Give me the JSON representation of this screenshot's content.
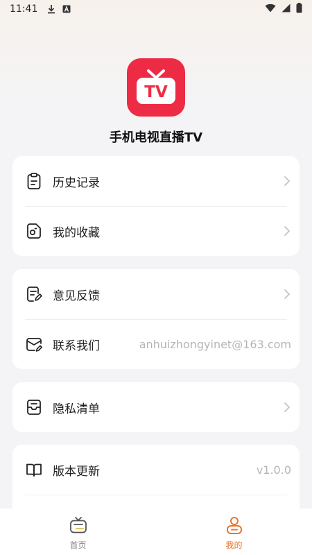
{
  "status_bar": {
    "time": "11:41"
  },
  "app": {
    "name": "手机电视直播TV",
    "logo_text": "TV"
  },
  "groups": [
    {
      "items": [
        {
          "label": "历史记录",
          "icon": "history-clipboard-icon"
        },
        {
          "label": "我的收藏",
          "icon": "favorites-icon"
        }
      ]
    },
    {
      "items": [
        {
          "label": "意见反馈",
          "icon": "feedback-icon"
        },
        {
          "label": "联系我们",
          "value": "anhuizhongyinet@163.com",
          "icon": "mail-icon"
        }
      ]
    },
    {
      "items": [
        {
          "label": "隐私清单",
          "icon": "privacy-list-icon"
        }
      ]
    },
    {
      "items": [
        {
          "label": "版本更新",
          "value": "v1.0.0",
          "icon": "book-icon"
        }
      ]
    }
  ],
  "tab_bar": {
    "tabs": [
      {
        "label": "首页",
        "icon": "tv-home-icon",
        "active": false
      },
      {
        "label": "我的",
        "icon": "profile-icon",
        "active": true
      }
    ]
  },
  "colors": {
    "brand_red": "#ee2b45",
    "accent_orange": "#e8762c"
  }
}
